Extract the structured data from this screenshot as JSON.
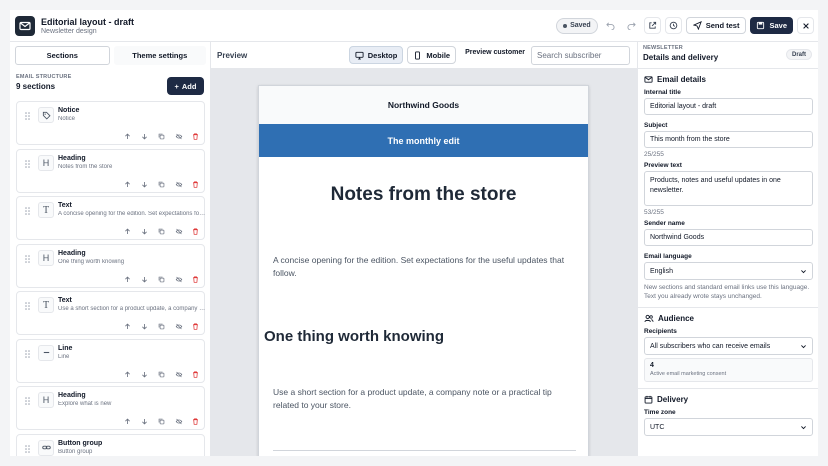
{
  "header": {
    "title": "Editorial layout - draft",
    "subtitle": "Newsletter design",
    "saved_label": "Saved",
    "send_test_label": "Send test",
    "save_label": "Save"
  },
  "left_panel": {
    "tabs": [
      "Sections",
      "Theme settings"
    ],
    "structure_label": "EMAIL STRUCTURE",
    "section_count": "9 sections",
    "add_label": "Add",
    "sections": [
      {
        "title": "Notice",
        "subtitle": "Notice",
        "icon": "tag-icon"
      },
      {
        "title": "Heading",
        "subtitle": "Notes from the store",
        "icon": "heading-icon"
      },
      {
        "title": "Text",
        "subtitle": "A concise opening for the edition. Set expectations for the useful updates that follow.",
        "icon": "text-icon"
      },
      {
        "title": "Heading",
        "subtitle": "One thing worth knowing",
        "icon": "heading-icon"
      },
      {
        "title": "Text",
        "subtitle": "Use a short section for a product update, a company note or a practical tip related to your store.",
        "icon": "text-icon"
      },
      {
        "title": "Line",
        "subtitle": "Line",
        "icon": "line-icon"
      },
      {
        "title": "Heading",
        "subtitle": "Explore what is new",
        "icon": "heading-icon"
      },
      {
        "title": "Button group",
        "subtitle": "Button group",
        "icon": "link-icon"
      }
    ]
  },
  "preview": {
    "label": "Preview",
    "desktop_label": "Desktop",
    "mobile_label": "Mobile",
    "customer_label": "Preview customer",
    "subscriber_placeholder": "Search subscriber",
    "email": {
      "brand": "Northwind Goods",
      "banner": "The monthly edit",
      "heading1": "Notes from the store",
      "para1": "A concise opening for the edition. Set expectations for the useful updates that follow.",
      "heading2": "One thing worth knowing",
      "para2": "Use a short section for a product update, a company note or a practical tip related to your store."
    }
  },
  "right_panel": {
    "kicker": "NEWSLETTER",
    "title": "Details and delivery",
    "badge": "Draft",
    "email_details": {
      "title": "Email details",
      "internal_title_label": "Internal title",
      "internal_title_value": "Editorial layout - draft",
      "subject_label": "Subject",
      "subject_value": "This month from the store",
      "subject_counter": "25/255",
      "preview_text_label": "Preview text",
      "preview_text_value": "Products, notes and useful updates in one newsletter.",
      "preview_counter": "53/255",
      "sender_label": "Sender name",
      "sender_value": "Northwind Goods",
      "language_label": "Email language",
      "language_value": "English",
      "language_help": "New sections and standard email links use this language. Text you already wrote stays unchanged."
    },
    "audience": {
      "title": "Audience",
      "recipients_label": "Recipients",
      "recipients_value": "All subscribers who can receive emails",
      "count": "4",
      "count_label": "Active email marketing consent"
    },
    "delivery": {
      "title": "Delivery",
      "timezone_label": "Time zone",
      "timezone_value": "UTC"
    }
  }
}
